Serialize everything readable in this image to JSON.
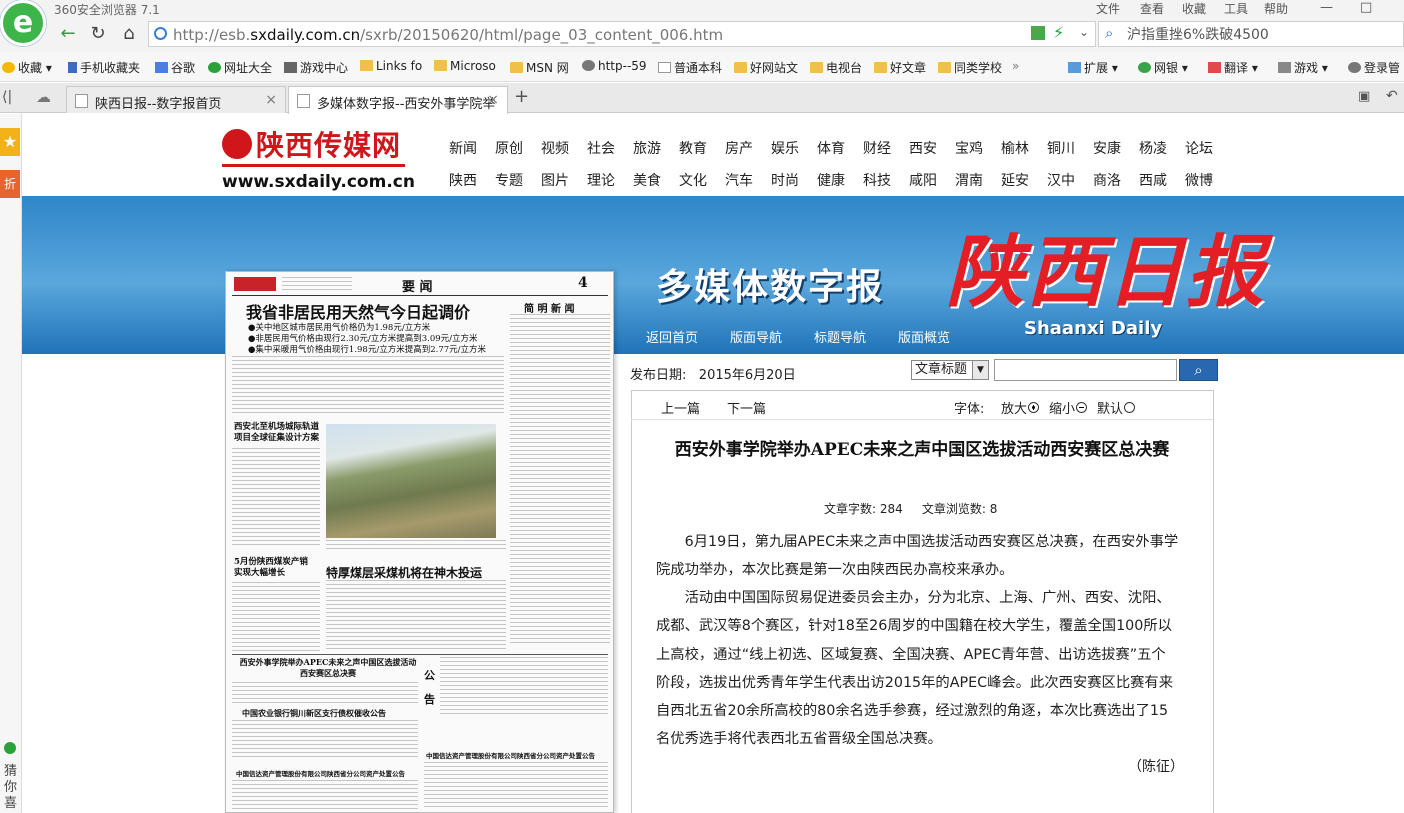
{
  "browser": {
    "app_title": "360安全浏览器 7.1",
    "menu": [
      "文件",
      "查看",
      "收藏",
      "工具",
      "帮助"
    ],
    "url_prefix": "http://esb.",
    "url_domain": "sxdaily.com.cn",
    "url_path": "/sxrb/20150620/html/page_03_content_006.htm",
    "search_value": "沪指重挫6%跌破4500",
    "bookmarks": [
      "收藏",
      "手机收藏夹",
      "谷歌",
      "网址大全",
      "游戏中心",
      "Links fo",
      "Microso",
      "MSN 网",
      "http--59",
      "普通本科",
      "好网站文",
      "电视台",
      "好文章",
      "同类学校",
      "扩展",
      "网银",
      "翻译",
      "游戏",
      "登录管"
    ],
    "tabs": [
      {
        "label": "陕西日报--数字报首页"
      },
      {
        "label": "多媒体数字报--西安外事学院举"
      }
    ],
    "tab_add": "+",
    "sidebar_bottom": "猜你喜"
  },
  "site": {
    "logo_cn": "陕西传媒网",
    "logo_url": "www.sxdaily.com.cn",
    "nav_row1": [
      "新闻",
      "原创",
      "视频",
      "社会",
      "旅游",
      "教育",
      "房产",
      "娱乐",
      "体育",
      "财经",
      "西安",
      "宝鸡",
      "榆林",
      "铜川",
      "安康",
      "杨凌",
      "论坛"
    ],
    "nav_row2": [
      "陕西",
      "专题",
      "图片",
      "理论",
      "美食",
      "文化",
      "汽车",
      "时尚",
      "健康",
      "科技",
      "咸阳",
      "渭南",
      "延安",
      "汉中",
      "商洛",
      "西咸",
      "微博"
    ]
  },
  "banner": {
    "title": "多媒体数字报",
    "brand": "陕西日报",
    "brand_en": "Shaanxi Daily",
    "nav": [
      "返回首页",
      "版面导航",
      "标题导航",
      "版面概览"
    ]
  },
  "paper": {
    "section": "要 闻",
    "page_no": "4",
    "headline": "我省非居民用天然气今日起调价",
    "bullets": [
      "●关中地区城市居民用气价格仍为1.98元/立方米",
      "●非居民用气价格由现行2.30元/立方米提高到3.09元/立方米",
      "●集中采暖用气价格由现行1.98元/立方米提高到2.77元/立方米"
    ],
    "side_head": "简 明 新 闻",
    "story2_title": "西安北至机场城际轨道\n项目全球征集设计方案",
    "story3_title": "5月份陕西煤炭产销\n实现大幅增长",
    "photo_caption": "特厚煤层采煤机将在神木投运",
    "story4_title": "西安外事学院举办APEC未来之声中国区选拔活动\n西安赛区总决赛",
    "notice1": "中国农业银行铜川新区支行债权催收公告",
    "notice2": "中国信达资产管理股份有限公司陕西省分公司资产处置公告",
    "notice3": "中国信达资产管理股份有限公司陕西省分公司资产处置公告",
    "announce": "公告"
  },
  "article": {
    "date_label": "发布日期:",
    "date_value": "2015年6月20日",
    "search_field": "文章标题",
    "prev": "上一篇",
    "next": "下一篇",
    "font_label": "字体:",
    "zoom_in": "放大",
    "zoom_out": "缩小",
    "default": "默认",
    "title": "西安外事学院举办APEC未来之声中国区选拔活动西安赛区总决赛",
    "word_count": "文章字数: 284",
    "view_count": "文章浏览数: 8",
    "p1": "6月19日，第九届APEC未来之声中国选拔活动西安赛区总决赛，在西安外事学院成功举办，本次比赛是第一次由陕西民办高校来承办。",
    "p2": "活动由中国国际贸易促进委员会主办，分为北京、上海、广州、西安、沈阳、成都、武汉等8个赛区，针对18至26周岁的中国籍在校大学生，覆盖全国100所以上高校，通过“线上初选、区域复赛、全国决赛、APEC青年营、出访选拔赛”五个阶段，选拔出优秀青年学生代表出访2015年的APEC峰会。此次西安赛区比赛有来自西北五省20余所高校的80余名选手参赛，经过激烈的角逐，本次比赛选出了15名优秀选手将代表西北五省晋级全国总决赛。",
    "author": "（陈征）"
  }
}
